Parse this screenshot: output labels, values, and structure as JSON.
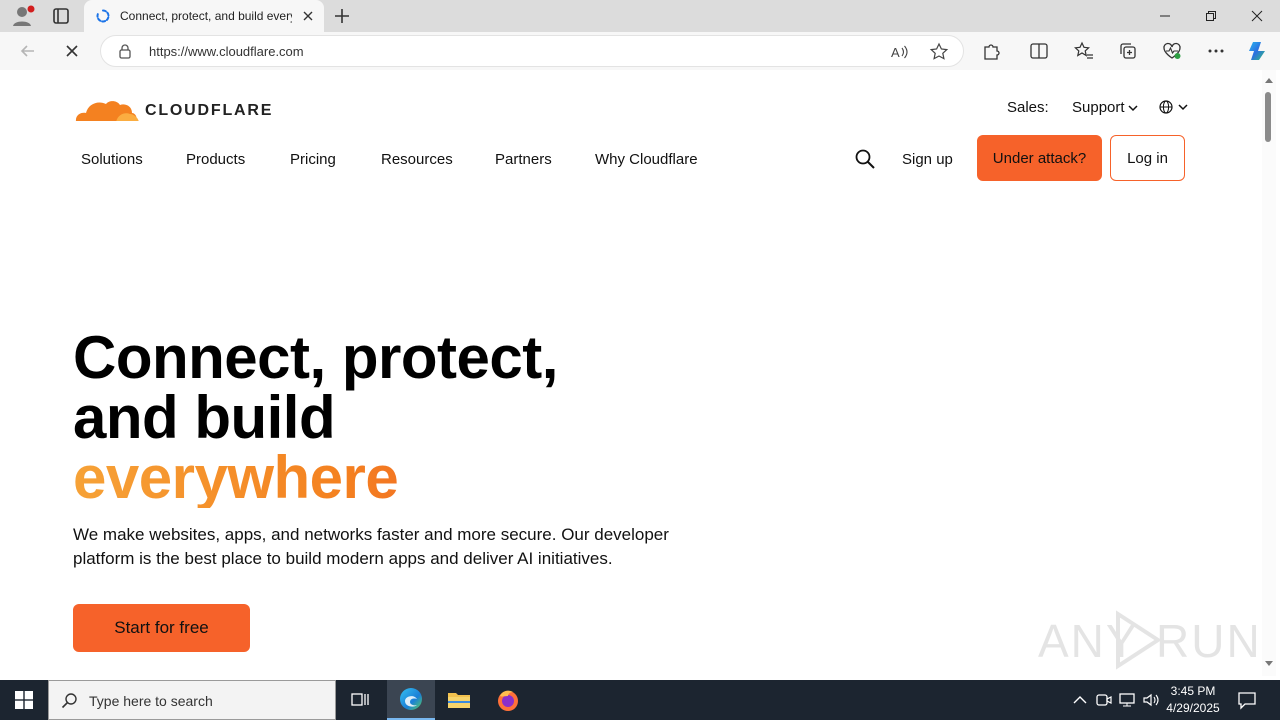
{
  "browser": {
    "tab_title": "Connect, protect, and build every",
    "url": "https://www.cloudflare.com"
  },
  "site": {
    "logo_text": "CLOUDFLARE",
    "brand_color": "#f6622a",
    "utility": {
      "sales": "Sales:",
      "support": "Support"
    },
    "nav": [
      "Solutions",
      "Products",
      "Pricing",
      "Resources",
      "Partners",
      "Why Cloudflare"
    ],
    "signup": "Sign up",
    "under_attack": "Under attack?",
    "login": "Log in",
    "hero": {
      "line1": "Connect, protect,",
      "line2": "and build",
      "line3": "everywhere"
    },
    "subtitle": "We make websites, apps, and networks faster and more secure. Our developer platform is the best place to build modern apps and deliver AI initiatives.",
    "cta": "Start for free"
  },
  "watermark": {
    "left": "ANY",
    "right": "RUN"
  },
  "taskbar": {
    "search_placeholder": "Type here to search",
    "time": "3:45 PM",
    "date": "4/29/2025"
  },
  "icons": {
    "profile": "profile-icon",
    "tabs": "tab-actions-icon",
    "spinner": "loading-spinner-icon",
    "back": "back-arrow-icon",
    "stop": "stop-loading-icon",
    "lock": "lock-icon",
    "read_aloud": "read-aloud-icon",
    "favorite": "star-icon",
    "extensions": "puzzle-icon",
    "split": "split-screen-icon",
    "favorites": "favorites-icon",
    "collections": "collections-icon",
    "performance": "heart-pulse-icon",
    "more": "more-icon",
    "copilot": "copilot-icon",
    "search": "search-icon",
    "globe": "globe-icon",
    "windows": "windows-icon"
  }
}
